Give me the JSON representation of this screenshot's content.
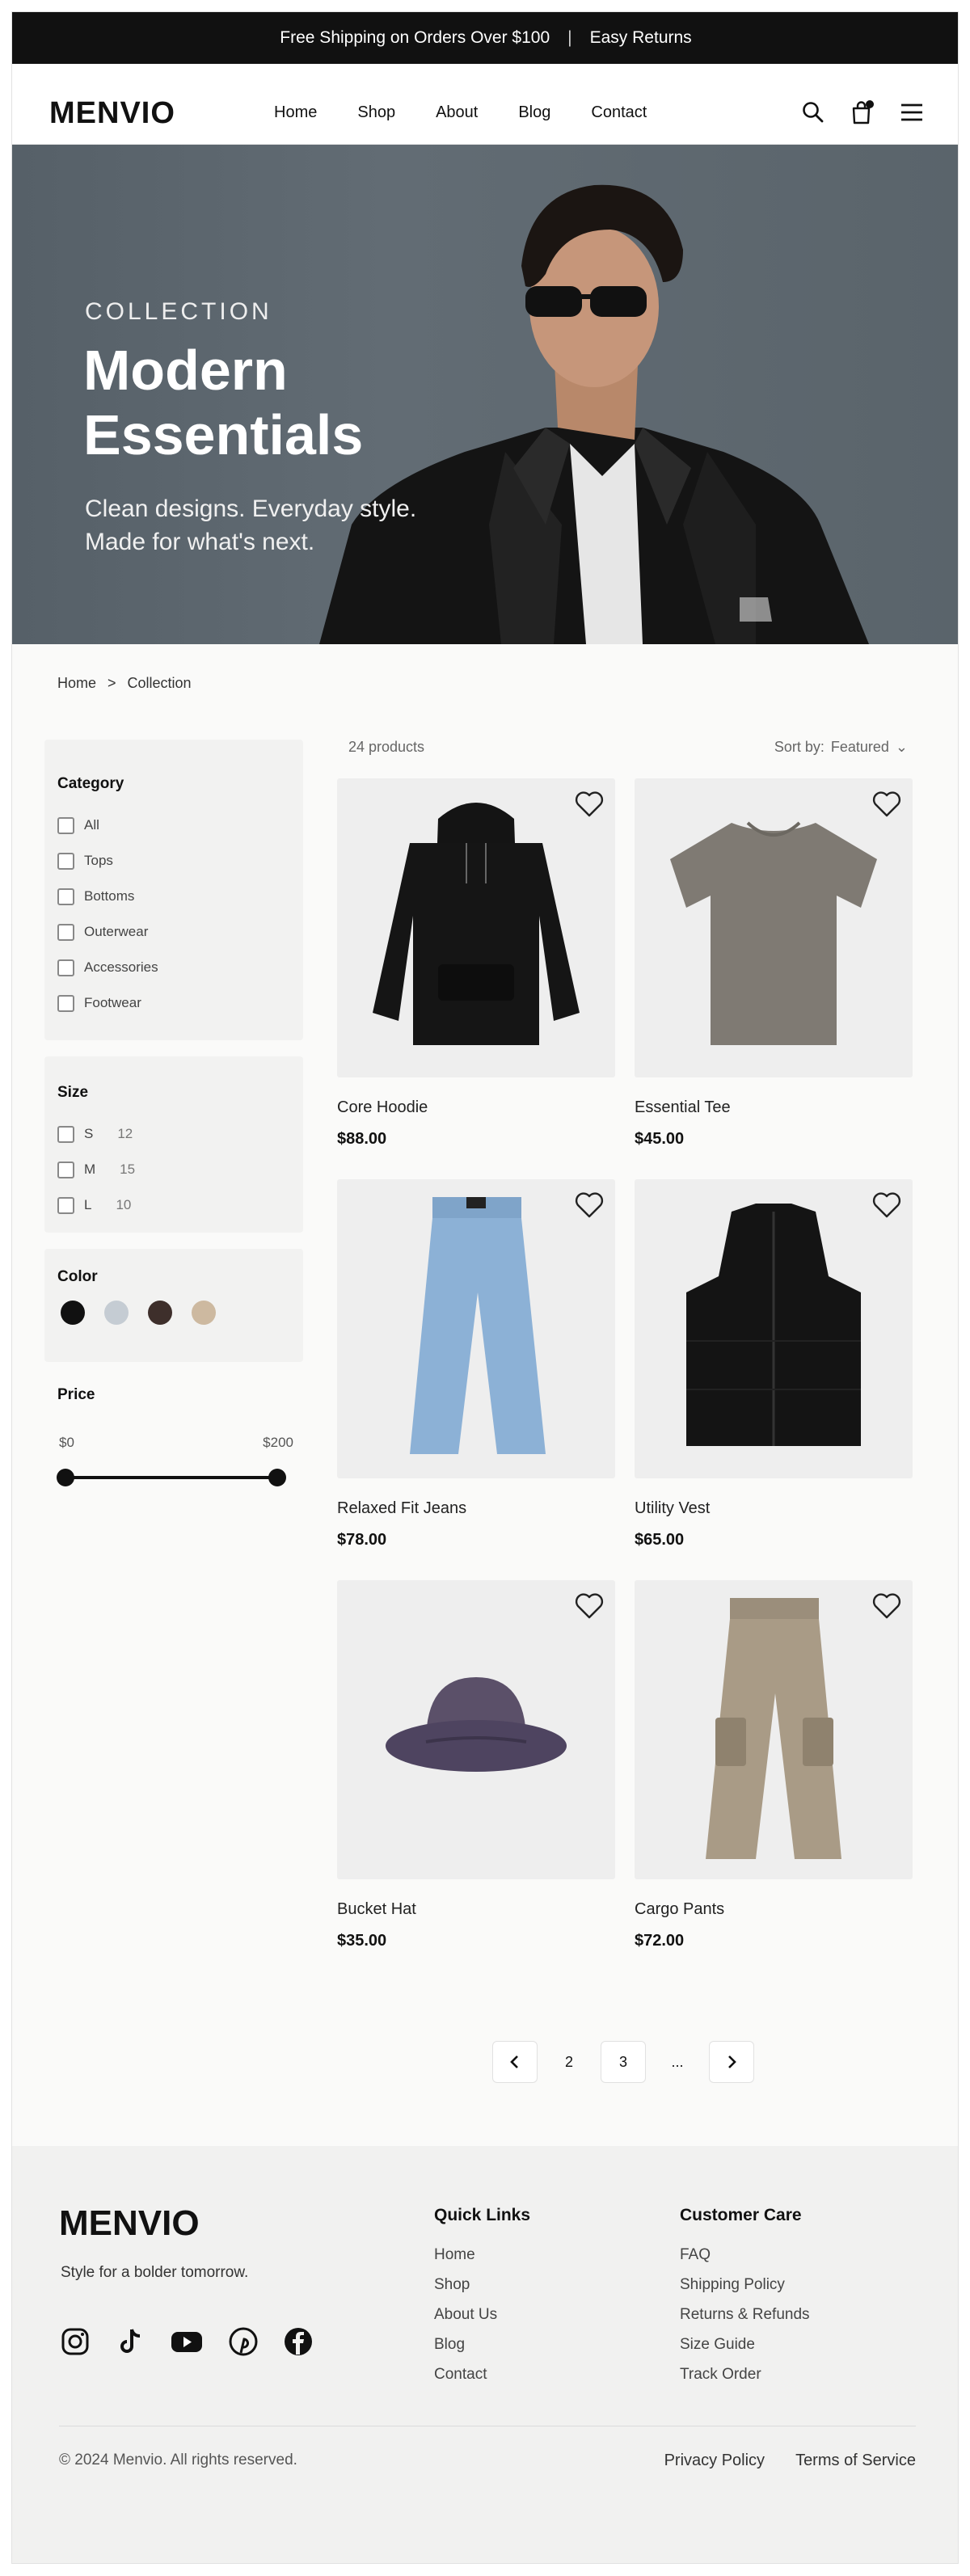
{
  "promo_bar": {
    "text": "Free Shipping on Orders Over $100",
    "separator": "|",
    "returns": "Easy Returns"
  },
  "header": {
    "logo": "MENVIO",
    "nav": [
      "Home",
      "Shop",
      "About",
      "Blog",
      "Contact"
    ],
    "icons": [
      "search-icon",
      "bag-icon",
      "menu-icon"
    ]
  },
  "hero": {
    "eyebrow": "COLLECTION",
    "title": "Modern Essentials",
    "subtitle": "Clean designs. Everyday style. Made for what's next."
  },
  "breadcrumb": {
    "home": "Home",
    "separator": ">",
    "current": "Collection"
  },
  "filters": {
    "category": {
      "title": "Category",
      "options": [
        "All",
        "Tops",
        "Bottoms",
        "Outerwear",
        "Accessories",
        "Footwear"
      ]
    },
    "size": {
      "title": "Size",
      "options": [
        {
          "label": "S",
          "count": "12"
        },
        {
          "label": "M",
          "count": "15"
        },
        {
          "label": "L",
          "count": "10"
        }
      ]
    },
    "color": {
      "title": "Color",
      "swatches": [
        "#111111",
        "#c5ccd3",
        "#3e2f2b",
        "#cdb9a0"
      ]
    },
    "price": {
      "title": "Price",
      "min": "$0",
      "max": "$200",
      "range_fraction": [
        0,
        1
      ]
    }
  },
  "results": {
    "count": "24 products",
    "sort_label": "Sort by:",
    "sort_value": "Featured"
  },
  "products": [
    {
      "name": "Core Hoodie",
      "price": "$88.00",
      "image": "hoodie"
    },
    {
      "name": "Essential Tee",
      "price": "$45.00",
      "image": "tee"
    },
    {
      "name": "Relaxed Fit Jeans",
      "price": "$78.00",
      "image": "jeans"
    },
    {
      "name": "Utility Vest",
      "price": "$65.00",
      "image": "vest"
    },
    {
      "name": "Bucket Hat",
      "price": "$35.00",
      "image": "hat"
    },
    {
      "name": "Cargo Pants",
      "price": "$72.00",
      "image": "cargo"
    }
  ],
  "pagination": {
    "pages": [
      "2",
      "3",
      "..."
    ]
  },
  "footer": {
    "logo": "MENVIO",
    "tagline": "Style for a bolder tomorrow.",
    "socials": [
      "instagram-icon",
      "tiktok-icon",
      "youtube-icon",
      "pinterest-icon",
      "facebook-icon"
    ],
    "quick_links": {
      "title": "Quick Links",
      "items": [
        "Home",
        "Shop",
        "About Us",
        "Blog",
        "Contact"
      ]
    },
    "customer_care": {
      "title": "Customer Care",
      "items": [
        "FAQ",
        "Shipping Policy",
        "Returns & Refunds",
        "Size Guide",
        "Track Order"
      ]
    },
    "copyright": "© 2024 Menvio. All rights reserved.",
    "legal": [
      "Privacy Policy",
      "Terms of Service"
    ]
  },
  "colors": {
    "promo_bg": "#111111",
    "page_bg": "#fafaf9",
    "accent": "#111111"
  }
}
